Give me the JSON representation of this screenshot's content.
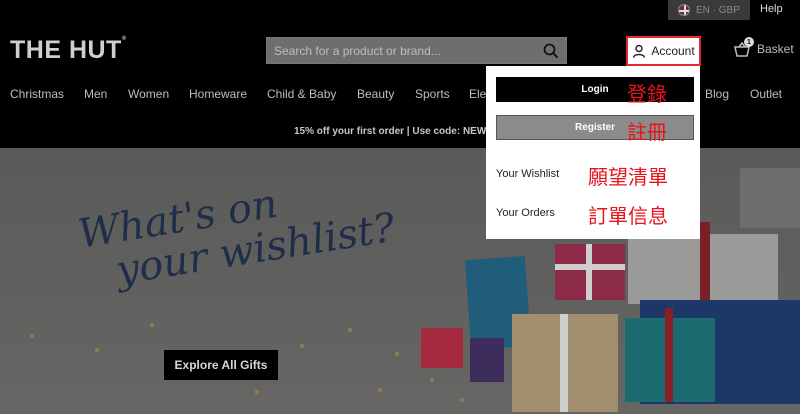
{
  "header": {
    "logo": "THE HUT",
    "logo_mark": "®",
    "locale": "EN · GBP",
    "help": "Help",
    "search_placeholder": "Search for a product or brand...",
    "account_label": "Account",
    "basket_label": "Basket",
    "basket_count": "1"
  },
  "nav": {
    "items": [
      "Christmas",
      "Men",
      "Women",
      "Homeware",
      "Child & Baby",
      "Beauty",
      "Sports",
      "Ele",
      "Blog",
      "Outlet"
    ]
  },
  "promo": {
    "text": "15% off your first order | Use code: NEW"
  },
  "hero": {
    "title_line1": "What's on",
    "title_line2": "your wishlist?",
    "cta": "Explore All Gifts"
  },
  "account_menu": {
    "login": "Login",
    "login_cn": "登錄",
    "register": "Register",
    "register_cn": "註冊",
    "wishlist": "Your Wishlist",
    "wishlist_cn": "願望清單",
    "orders": "Your Orders",
    "orders_cn": "訂單信息"
  },
  "colors": {
    "highlight": "#e0282e",
    "annotation": "#e8141b",
    "hero_text": "#1e2d49"
  }
}
